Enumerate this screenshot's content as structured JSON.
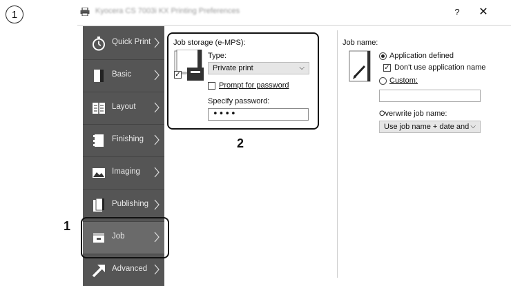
{
  "step_number": "1",
  "window": {
    "title": "Kyocera CS 7003i KX Printing Preferences",
    "help_label": "?",
    "close_label": "✕"
  },
  "sidebar": {
    "items": [
      {
        "label": "Quick Print",
        "icon": "stopwatch-icon"
      },
      {
        "label": "Basic",
        "icon": "page-icon"
      },
      {
        "label": "Layout",
        "icon": "layout-icon"
      },
      {
        "label": "Finishing",
        "icon": "finishing-icon"
      },
      {
        "label": "Imaging",
        "icon": "image-icon"
      },
      {
        "label": "Publishing",
        "icon": "publishing-icon"
      },
      {
        "label": "Job",
        "icon": "job-icon"
      },
      {
        "label": "Advanced",
        "icon": "arrow-icon"
      }
    ],
    "active": "Job"
  },
  "job_storage": {
    "section_label": "Job storage (e-MPS):",
    "type_label": "Type:",
    "type_value": "Private print",
    "prompt_label": "Prompt for password",
    "specify_label": "Specify password:",
    "password_value": "••••",
    "storage_checked": true,
    "prompt_checked": false
  },
  "job_name": {
    "section_label": "Job name:",
    "app_defined_label": "Application defined",
    "dont_use_label": "Don't use application name",
    "custom_label": "Custom:",
    "custom_value": "",
    "overwrite_label": "Overwrite job name:",
    "overwrite_value": "Use job name + date and t",
    "app_defined_selected": true,
    "dont_use_checked": true
  },
  "callouts": {
    "one": "1",
    "two": "2"
  }
}
